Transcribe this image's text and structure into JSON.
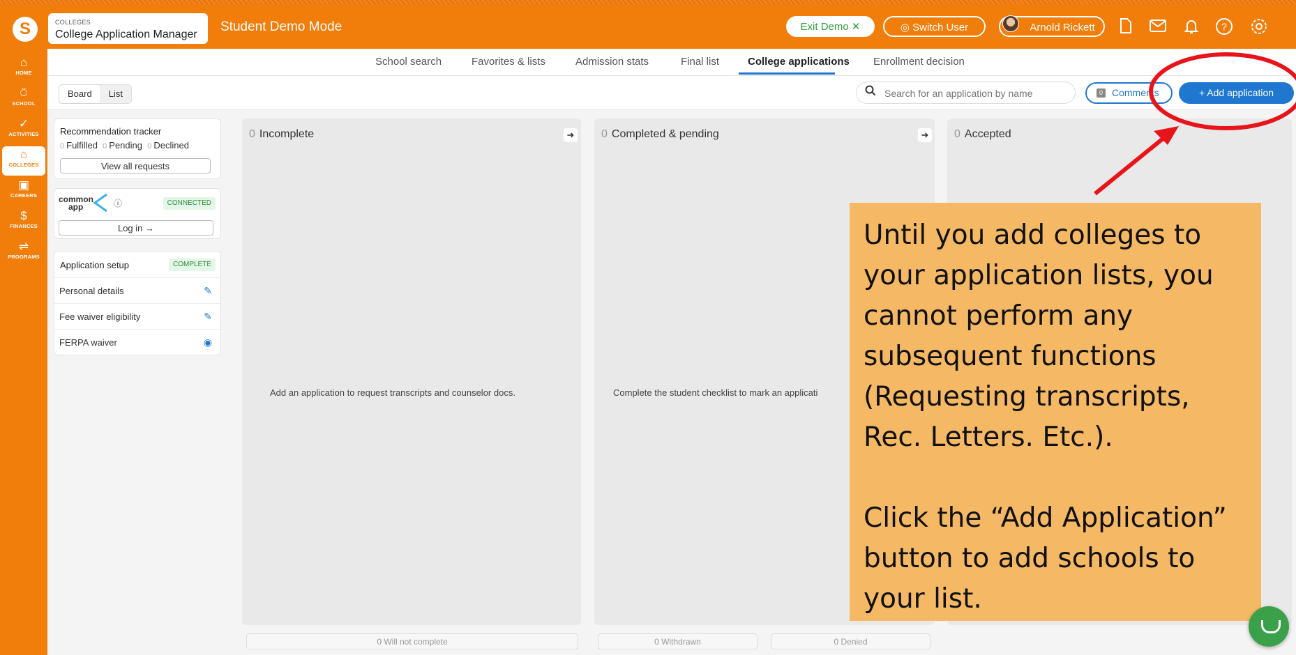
{
  "topbar": {
    "logo_glyph": "S",
    "app_section": "COLLEGES",
    "app_name": "College Application Manager",
    "mode_title": "Student Demo Mode",
    "exit_demo": "Exit Demo ✕",
    "switch_user": "Switch User",
    "user_name": "Arnold Rickett",
    "icons": [
      "document-icon",
      "mail-icon",
      "bell-icon",
      "help-icon",
      "settings-icon"
    ]
  },
  "sidebar": {
    "items": [
      {
        "label": "HOME",
        "icon": "home-icon",
        "glyph": "⌂"
      },
      {
        "label": "SCHOOL",
        "icon": "apple-icon",
        "glyph": "⍥"
      },
      {
        "label": "ACTIVITIES",
        "icon": "check-circle-icon",
        "glyph": "✓"
      },
      {
        "label": "COLLEGES",
        "icon": "college-icon",
        "glyph": "⌂"
      },
      {
        "label": "CAREERS",
        "icon": "briefcase-icon",
        "glyph": "▣"
      },
      {
        "label": "FINANCES",
        "icon": "money-bag-icon",
        "glyph": "$"
      },
      {
        "label": "PROGRAMS",
        "icon": "handshake-icon",
        "glyph": "⇌"
      }
    ],
    "active": "COLLEGES"
  },
  "tabs": [
    {
      "label": "School search"
    },
    {
      "label": "Favorites & lists"
    },
    {
      "label": "Admission stats"
    },
    {
      "label": "Final list"
    },
    {
      "label": "College applications"
    },
    {
      "label": "Enrollment decision"
    }
  ],
  "active_tab": "College applications",
  "toolbar": {
    "view_board": "Board",
    "view_list": "List",
    "search_placeholder": "Search for an application by name",
    "comments_count": "0",
    "comments_label": "Comments",
    "add_label": "+ Add application"
  },
  "recommendation": {
    "title": "Recommendation tracker",
    "fulfilled_n": "0",
    "fulfilled": "Fulfilled",
    "pending_n": "0",
    "pending": "Pending",
    "declined_n": "0",
    "declined": "Declined",
    "view_all": "View all requests"
  },
  "commonapp": {
    "logo_top": "common",
    "logo_bottom": "app",
    "status": "CONNECTED",
    "login": "Log in →"
  },
  "setup": {
    "title": "Application setup",
    "status": "COMPLETE",
    "rows": [
      {
        "label": "Personal details",
        "icon": "pencil-icon"
      },
      {
        "label": "Fee waiver eligibility",
        "icon": "pencil-icon"
      },
      {
        "label": "FERPA waiver",
        "icon": "eye-icon"
      }
    ]
  },
  "columns": [
    {
      "count": "0",
      "title": "Incomplete",
      "message": "Add an application to request transcripts and counselor docs."
    },
    {
      "count": "0",
      "title": "Completed & pending",
      "message": "Complete the student checklist to mark an applicati"
    },
    {
      "count": "0",
      "title": "Accepted",
      "message": ""
    }
  ],
  "drop_zones": [
    "0  Will not complete",
    "0  Withdrawn",
    "0  Denied"
  ],
  "callout": {
    "paragraph1": "Until you add colleges to your application lists, you cannot perform any subsequent functions (Requesting transcripts, Rec. Letters. Etc.).",
    "paragraph2": "Click the “Add Application” button to add schools to your list."
  },
  "colors": {
    "brand_orange": "#f17d0b",
    "accent_blue": "#1f77d0",
    "annotation_red": "#e8141b",
    "callout_bg": "#f5b865"
  }
}
